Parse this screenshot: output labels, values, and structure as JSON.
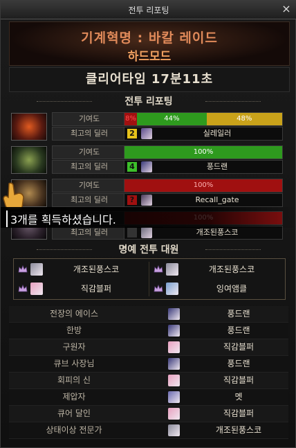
{
  "window": {
    "title": "전투 리포팅",
    "close_label": "×"
  },
  "raid": {
    "name": "기계혁명 : 바칼 레이드",
    "mode": "하드모드",
    "clear_time": "클리어타임 17분11초"
  },
  "sections": {
    "report": "전투 리포팅",
    "honor": "명예 전투 대원"
  },
  "labels": {
    "contribution": "기여도",
    "best_dealer": "최고의 딜러"
  },
  "colors": {
    "green": "#2e9a1e",
    "gold": "#c9a21a",
    "red": "#a01010",
    "rank_yellow": "#e6c21a",
    "rank_green": "#3cbf2a"
  },
  "parties": [
    {
      "portrait": "fire-boss",
      "segments": [
        {
          "text": "8%",
          "value": 8,
          "color": "#a01010",
          "text_color": "#ff5050"
        },
        {
          "text": "44%",
          "value": 44,
          "color": "#2e9a1e",
          "text_color": "#ffffff"
        },
        {
          "text": "48%",
          "value": 48,
          "color": "#c9a21a",
          "text_color": "#ffffff"
        }
      ],
      "dealer": {
        "rank": "2",
        "rank_color": "#e6c21a",
        "name": "실레일러",
        "avatar": "#5a4a8a"
      }
    },
    {
      "portrait": "green-boss",
      "segments": [
        {
          "text": "100%",
          "value": 100,
          "color": "#2e9a1e",
          "text_color": "#ffffff"
        }
      ],
      "dealer": {
        "rank": "4",
        "rank_color": "#3cbf2a",
        "name": "풍드랜",
        "avatar": "#3a3a7a"
      }
    },
    {
      "portrait": "gold-boss",
      "segments": [
        {
          "text": "100%",
          "value": 100,
          "color": "#a01010",
          "text_color": "#ffb0b0"
        }
      ],
      "dealer": {
        "rank": "?",
        "rank_color": "#a01010",
        "name": "Recall_gate",
        "avatar": "#4a3a5a"
      }
    },
    {
      "portrait": "dark-boss",
      "segments": [
        {
          "text": "100%",
          "value": 100,
          "color": "#8a1010",
          "text_color": "#ffb0b0"
        }
      ],
      "dealer": {
        "rank": "",
        "rank_color": "#333333",
        "name": "개조된풍스코",
        "avatar": "#6a6a7a"
      }
    }
  ],
  "toast": {
    "text": "3개를 획득하셨습니다."
  },
  "honor_members": [
    {
      "name": "개조된풍스코",
      "avatar": "#8a8a9a"
    },
    {
      "name": "개조된풍스코",
      "avatar": "#8a8a9a"
    },
    {
      "name": "직감블퍼",
      "avatar": "#e8a0c0"
    },
    {
      "name": "잉여앰클",
      "avatar": "#7aa0d0"
    }
  ],
  "awards": [
    {
      "title": "전장의 에이스",
      "player": "풍드랜",
      "avatar": "#3a3a7a"
    },
    {
      "title": "한방",
      "player": "풍드랜",
      "avatar": "#3a3a7a"
    },
    {
      "title": "구원자",
      "player": "직감블퍼",
      "avatar": "#e8a0c0"
    },
    {
      "title": "큐브 사장님",
      "player": "풍드랜",
      "avatar": "#3a3a7a"
    },
    {
      "title": "회피의 신",
      "player": "직감블퍼",
      "avatar": "#e8a0c0"
    },
    {
      "title": "제압자",
      "player": "멧",
      "avatar": "#6a6ab0"
    },
    {
      "title": "큐어 달인",
      "player": "직감블퍼",
      "avatar": "#e8a0c0"
    },
    {
      "title": "상태이상 전문가",
      "player": "개조된풍스코",
      "avatar": "#8a8a9a"
    }
  ]
}
